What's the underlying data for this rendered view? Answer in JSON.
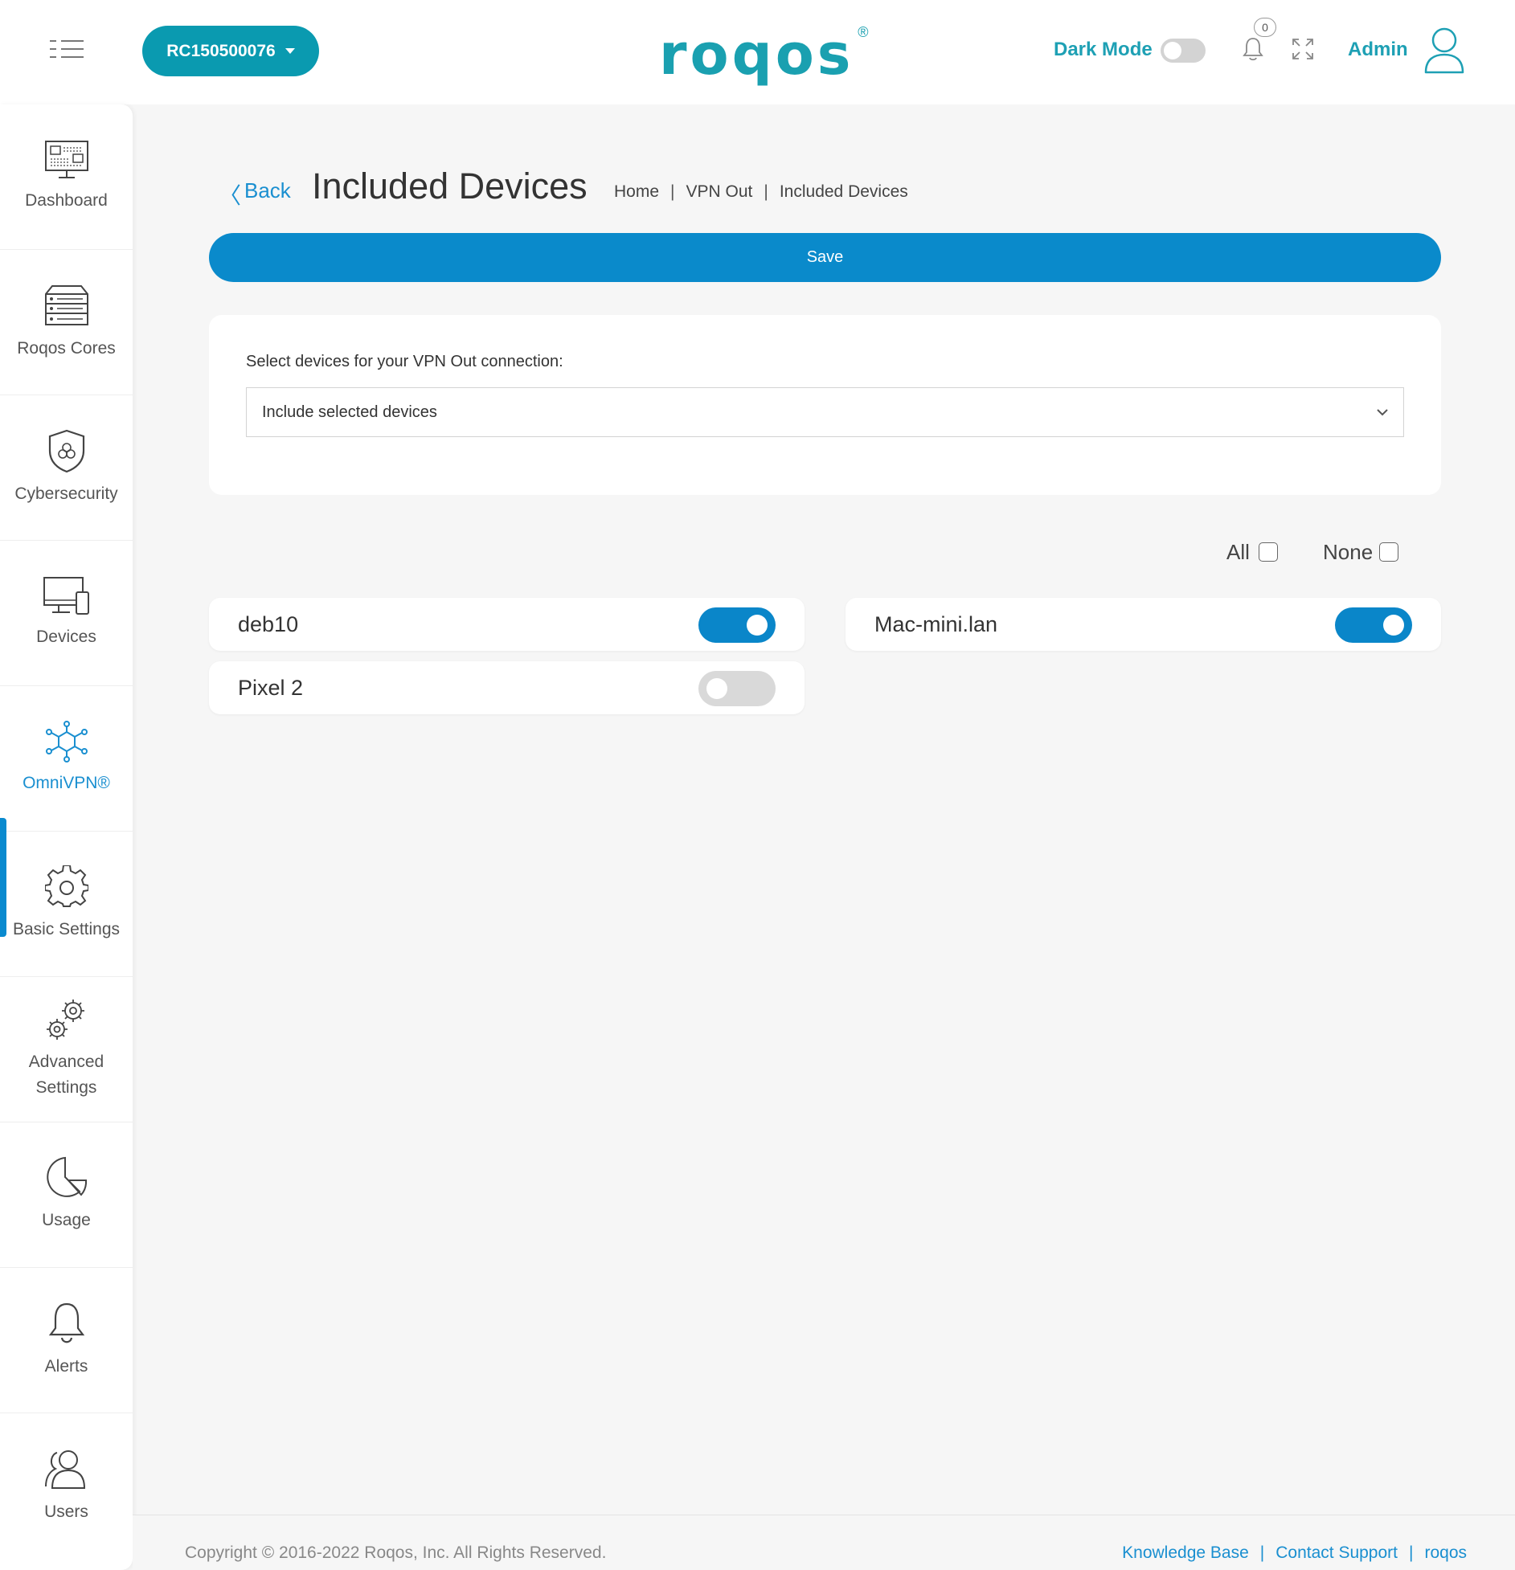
{
  "header": {
    "router_id": "RC150500076",
    "logo": "roqos",
    "logo_mark": "®",
    "dark_mode_label": "Dark Mode",
    "dark_mode_on": false,
    "notifications_count": "0",
    "user_label": "Admin"
  },
  "sidebar": {
    "items": [
      {
        "label": "Dashboard",
        "icon": "dashboard-icon"
      },
      {
        "label": "Roqos Cores",
        "icon": "server-icon"
      },
      {
        "label": "Cybersecurity",
        "icon": "shield-icon"
      },
      {
        "label": "Devices",
        "icon": "devices-icon"
      },
      {
        "label": "OmniVPN®",
        "icon": "network-icon",
        "active": true
      },
      {
        "label": "Basic Settings",
        "icon": "gear-icon"
      },
      {
        "label": "Advanced\nSettings",
        "icon": "gears-icon"
      },
      {
        "label": "Usage",
        "icon": "pie-chart-icon"
      },
      {
        "label": "Alerts",
        "icon": "bell-icon"
      },
      {
        "label": "Users",
        "icon": "users-icon"
      }
    ]
  },
  "page": {
    "back_label": "Back",
    "title": "Included Devices",
    "breadcrumb": [
      "Home",
      "VPN Out",
      "Included Devices"
    ],
    "save_label": "Save",
    "select_label": "Select devices for your VPN Out connection:",
    "select_value": "Include selected devices",
    "all_label": "All",
    "none_label": "None",
    "all_checked": false,
    "none_checked": false
  },
  "devices": [
    {
      "name": "deb10",
      "enabled": true
    },
    {
      "name": "Mac-mini.lan",
      "enabled": true
    },
    {
      "name": "Pixel 2",
      "enabled": false
    }
  ],
  "footer": {
    "copyright": "Copyright © 2016-2022 Roqos, Inc. All Rights Reserved.",
    "links": [
      "Knowledge Base",
      "Contact Support",
      "roqos"
    ]
  },
  "colors": {
    "accent": "#0a8acb",
    "brand": "#1aa0b0"
  }
}
